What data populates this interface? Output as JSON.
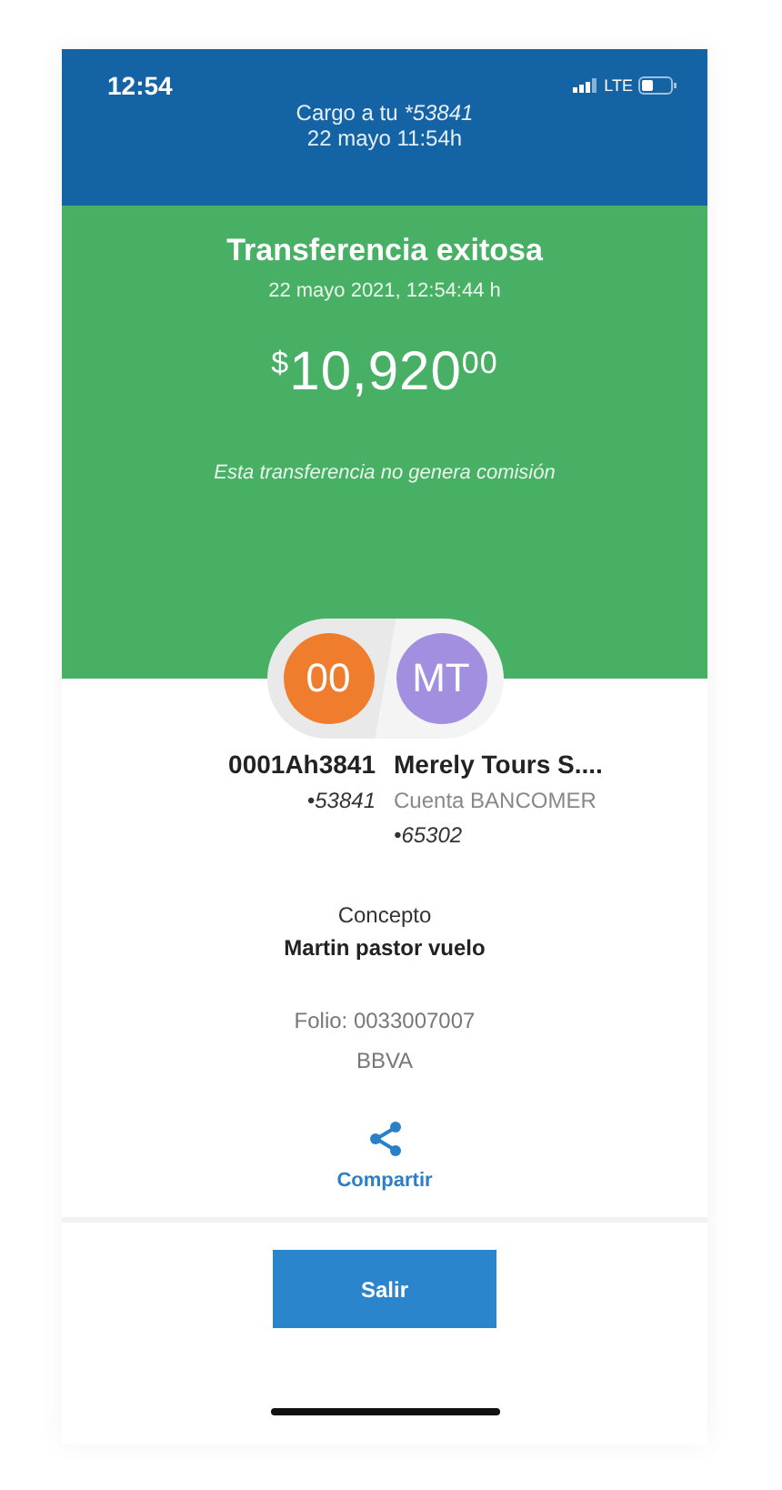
{
  "status_bar": {
    "time": "12:54",
    "network": "LTE"
  },
  "header": {
    "charge_label": "Cargo a tu",
    "account": "*53841",
    "datetime": "22 mayo 11:54h"
  },
  "result": {
    "title": "Transferencia exitosa",
    "datetime": "22 mayo 2021, 12:54:44 h",
    "currency": "$",
    "amount": "10,920",
    "cents": "00",
    "note": "Esta transferencia no genera comisión"
  },
  "parties": [
    {
      "initials": "00",
      "color": "#f07d2e",
      "name": "0001Ah3841",
      "account": "•53841"
    },
    {
      "initials": "MT",
      "color": "#a38fe0",
      "name": "Merely Tours S....",
      "bank": "Cuenta BANCOMER",
      "account": "•65302"
    }
  ],
  "concept": {
    "label": "Concepto",
    "value": "Martin pastor vuelo"
  },
  "folio": "Folio: 0033007007",
  "bank": "BBVA",
  "share": {
    "label": "Compartir"
  },
  "exit_button": "Salir"
}
